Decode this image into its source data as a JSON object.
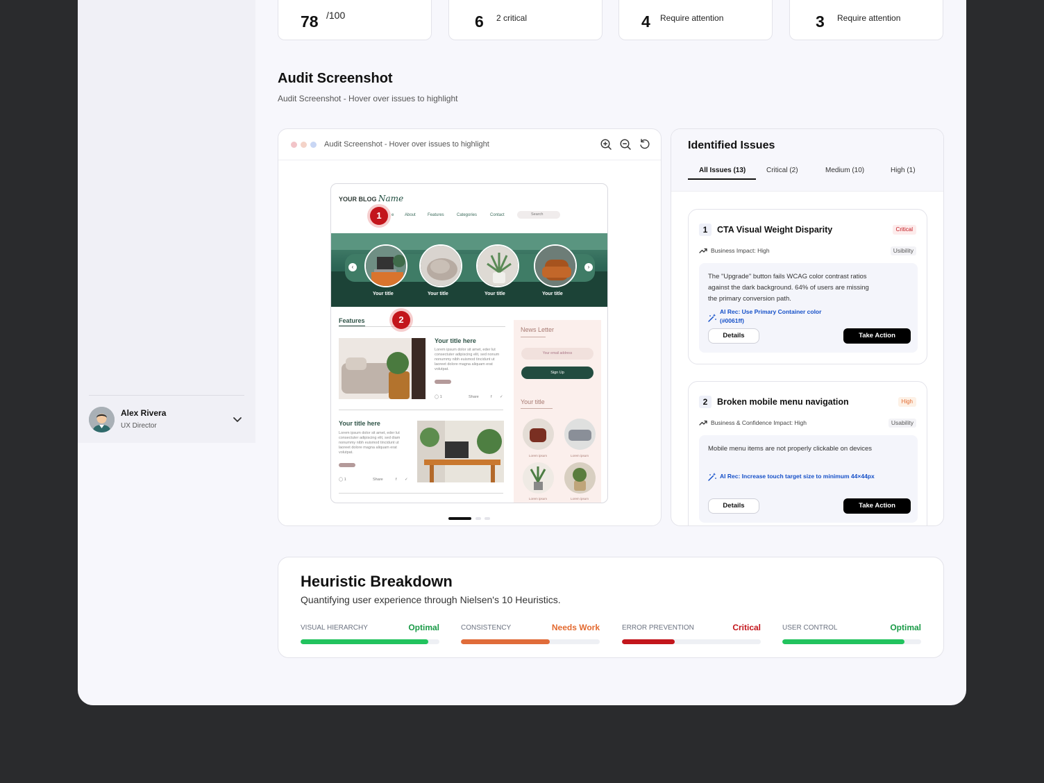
{
  "user": {
    "name": "Alex Rivera",
    "role": "UX Director"
  },
  "kpis": [
    {
      "value": "78",
      "sub": "/100"
    },
    {
      "value": "6",
      "sub": "2 critical"
    },
    {
      "value": "4",
      "sub": "Require attention"
    },
    {
      "value": "3",
      "sub": "Require attention"
    }
  ],
  "section": {
    "title": "Audit Screenshot",
    "subtitle": "Audit Screenshot - Hover over issues to highlight"
  },
  "viewer": {
    "title": "Audit Screenshot - Hover over issues to highlight",
    "tools": [
      "zoom-in-icon",
      "zoom-out-icon",
      "reset-icon"
    ],
    "markers": [
      "1",
      "2"
    ]
  },
  "mockup": {
    "logo": "YOUR BLOG",
    "logo_script": "Name",
    "nav": [
      "About",
      "Features",
      "Categories",
      "Contact"
    ],
    "nav_home_fragment": "e",
    "search": "Search",
    "hero_captions": [
      "Your title",
      "Your title",
      "Your title",
      "Your title"
    ],
    "features": "Features",
    "post1": {
      "title": "Your title here",
      "lorem": "Lorem ipsum dolor sit amet, eder lut consectuter adipiscing elit, sed nonum nonummy nibh euismod tincidunt ut laoreet dolore magna aliquam erat volutpat.",
      "comments": "1",
      "share": "Share"
    },
    "post2": {
      "title": "Your title here",
      "lorem": "Lorem ipsum dolor sit amet, eder lut consectuter adipiscing elit, sed diam nonummy nibh euismod tincidunt ut laoreet dolore magna aliquam erat volutpat.",
      "comments": "1",
      "share": "Share"
    },
    "newsletter": {
      "title": "News Letter",
      "placeholder": "Your email address",
      "button": "Sign Up"
    },
    "side_title": "Your title",
    "thumb_caption": "Lorem ipsum"
  },
  "issues": {
    "title": "Identified Issues",
    "tabs": [
      "All Issues (13)",
      "Critical (2)",
      "Medium (10)",
      "High (1)"
    ],
    "items": [
      {
        "num": "1",
        "title": "CTA Visual Weight Disparity",
        "severity": "Critical",
        "impact": "Business Impact: High",
        "category": "Usibility",
        "description": "The \"Upgrade\" button fails WCAG color contrast ratios against the dark background. 64% of users are missing the primary conversion path.",
        "ai_rec": "AI Rec: Use Primary Container color (#0061ff)",
        "details": "Details",
        "action": "Take Action"
      },
      {
        "num": "2",
        "title": "Broken mobile menu navigation",
        "severity": "High",
        "impact": "Business & Confidence Impact: High",
        "category": "Usability",
        "description": "Mobile menu items are not properly clickable on devices",
        "ai_rec": "AI Rec: Increase touch target size to minimum 44×44px",
        "details": "Details",
        "action": "Take Action"
      }
    ]
  },
  "heuristics": {
    "title": "Heuristic Breakdown",
    "subtitle": "Quantifying user experience through Nielsen's 10 Heuristics.",
    "metrics": [
      {
        "label": "VISUAL HIERARCHY",
        "status": "Optimal",
        "color": "#1a9a47",
        "bar": "#22c35e",
        "progress": 0.92
      },
      {
        "label": "CONSISTENCY",
        "status": "Needs Work",
        "color": "#e36a30",
        "bar": "#e06c3a",
        "progress": 0.64
      },
      {
        "label": "ERROR PREVENTION",
        "status": "Critical",
        "color": "#c3161c",
        "bar": "#c3161c",
        "progress": 0.38
      },
      {
        "label": "USER CONTROL",
        "status": "Optimal",
        "color": "#1a9a47",
        "bar": "#22c35e",
        "progress": 0.88
      }
    ]
  }
}
